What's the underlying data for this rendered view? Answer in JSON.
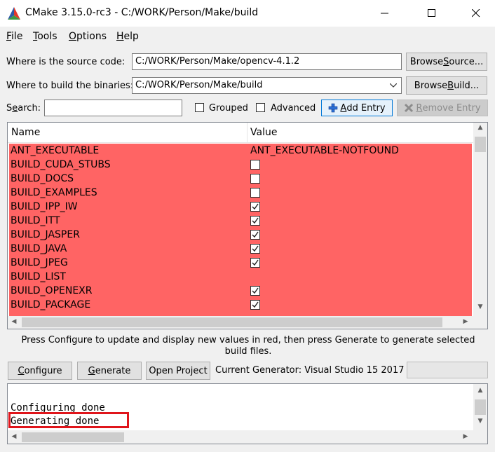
{
  "window": {
    "title": "CMake 3.15.0-rc3 - C:/WORK/Person/Make/build"
  },
  "menu": [
    {
      "pre": "",
      "u": "F",
      "post": "ile"
    },
    {
      "pre": "",
      "u": "T",
      "post": "ools"
    },
    {
      "pre": "",
      "u": "O",
      "post": "ptions"
    },
    {
      "pre": "",
      "u": "H",
      "post": "elp"
    }
  ],
  "source": {
    "label": "Where is the source code:",
    "value": "C:/WORK/Person/Make/opencv-4.1.2",
    "browse_pre": "Browse ",
    "browse_u": "S",
    "browse_post": "ource..."
  },
  "build": {
    "label": "Where to build the binaries:",
    "value": "C:/WORK/Person/Make/build",
    "browse_pre": "Browse ",
    "browse_u": "B",
    "browse_post": "uild..."
  },
  "search": {
    "pre": "S",
    "u": "e",
    "post": "arch:",
    "value": ""
  },
  "options": {
    "grouped": "Grouped",
    "advanced": "Advanced"
  },
  "entry_buttons": {
    "add_pre": "",
    "add_u": "A",
    "add_post": "dd Entry",
    "remove_pre": "",
    "remove_u": "R",
    "remove_post": "emove Entry"
  },
  "table": {
    "col_name": "Name",
    "col_value": "Value",
    "rows": [
      {
        "name": "ANT_EXECUTABLE",
        "type": "text",
        "value": "ANT_EXECUTABLE-NOTFOUND"
      },
      {
        "name": "BUILD_CUDA_STUBS",
        "type": "bool",
        "checked": false
      },
      {
        "name": "BUILD_DOCS",
        "type": "bool",
        "checked": false
      },
      {
        "name": "BUILD_EXAMPLES",
        "type": "bool",
        "checked": false
      },
      {
        "name": "BUILD_IPP_IW",
        "type": "bool",
        "checked": true
      },
      {
        "name": "BUILD_ITT",
        "type": "bool",
        "checked": true
      },
      {
        "name": "BUILD_JASPER",
        "type": "bool",
        "checked": true
      },
      {
        "name": "BUILD_JAVA",
        "type": "bool",
        "checked": true
      },
      {
        "name": "BUILD_JPEG",
        "type": "bool",
        "checked": true
      },
      {
        "name": "BUILD_LIST",
        "type": "text",
        "value": ""
      },
      {
        "name": "BUILD_OPENEXR",
        "type": "bool",
        "checked": true
      },
      {
        "name": "BUILD_PACKAGE",
        "type": "bool",
        "checked": true
      }
    ]
  },
  "info_text": "Press Configure to update and display new values in red, then press Generate to generate selected build files.",
  "actions": {
    "configure_pre": "",
    "configure_u": "C",
    "configure_post": "onfigure",
    "generate_pre": "",
    "generate_u": "G",
    "generate_post": "enerate",
    "open_pre": "Open Pro",
    "open_u": "j",
    "open_post": "ect"
  },
  "generator": "Current Generator: Visual Studio 15 2017",
  "log": [
    "Configuring done",
    "Generating done"
  ],
  "colors": {
    "changed_row": "#ff6464",
    "highlight": "#e0151b"
  }
}
